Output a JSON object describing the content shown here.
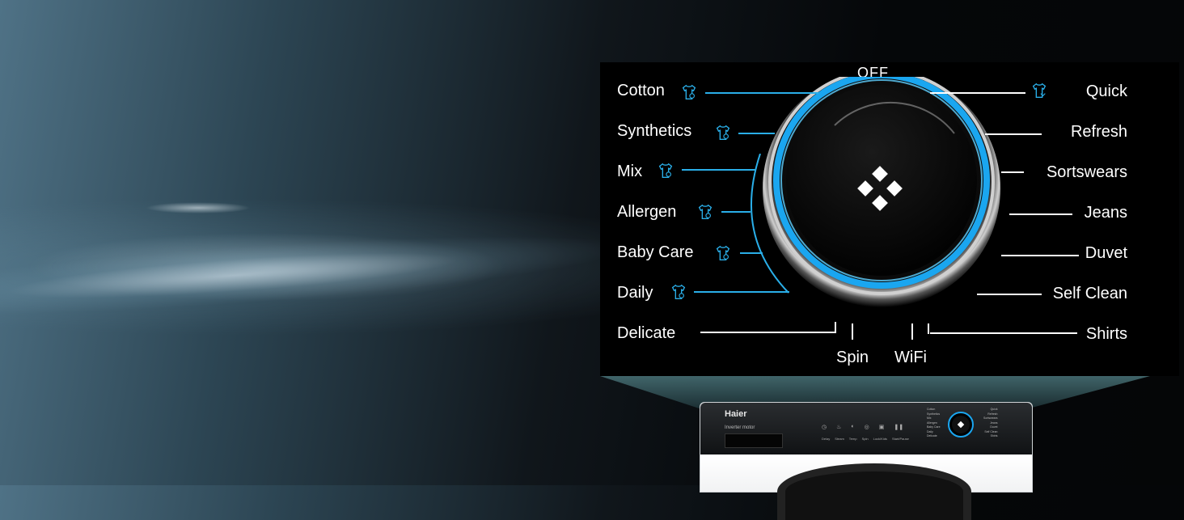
{
  "dial": {
    "off_label": "OFF",
    "left_programs": [
      "Cotton",
      "Synthetics",
      "Mix",
      "Allergen",
      "Baby Care",
      "Daily",
      "Delicate"
    ],
    "right_programs": [
      "Quick",
      "Refresh",
      "Sortswears",
      "Jeans",
      "Duvet",
      "Self Clean",
      "Shirts"
    ],
    "bottom_programs": [
      "Spin",
      "WiFi"
    ],
    "accent_color": "#2aaee8",
    "ring_color": "#17b4ff"
  },
  "machine": {
    "brand": "Haier",
    "series": "Inverter motor",
    "buttons": [
      "Delay",
      "Steam",
      "Temp",
      "Spin",
      "Lock/Kids",
      "Start/Pause"
    ],
    "mini_left": [
      "Cotton",
      "Synthetics",
      "Mix",
      "Allergen",
      "Baby Care",
      "Daily",
      "Delicate"
    ],
    "mini_right": [
      "Quick",
      "Refresh",
      "Sortswears",
      "Jeans",
      "Duvet",
      "Self Clean",
      "Shirts"
    ]
  }
}
